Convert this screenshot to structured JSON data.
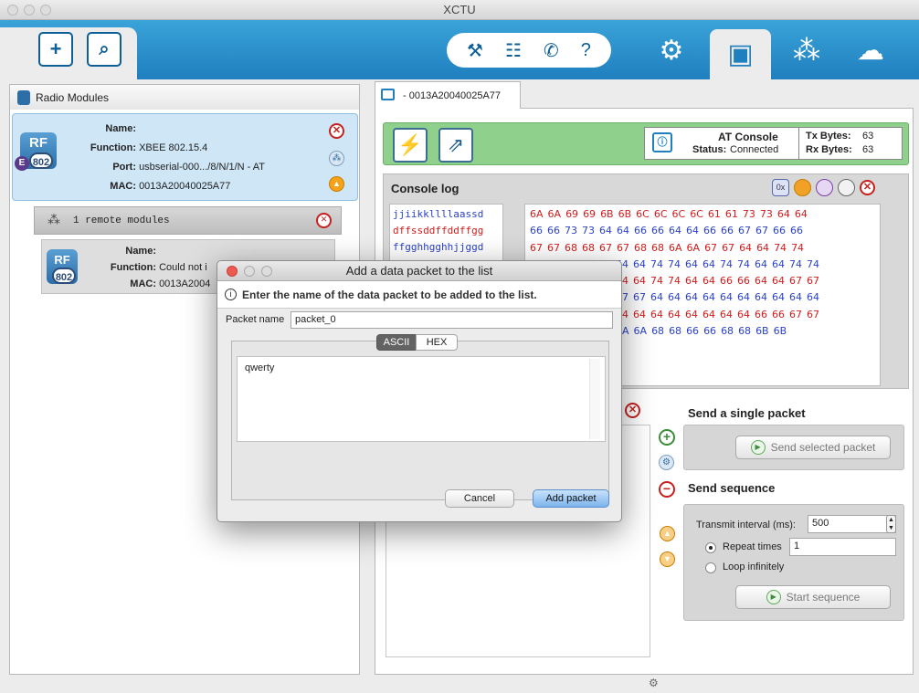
{
  "window": {
    "title": "XCTU"
  },
  "left_panel": {
    "header": "Radio Modules",
    "module": {
      "name_label": "Name:",
      "name_value": "",
      "function_label": "Function:",
      "function_value": "XBEE 802.15.4",
      "port_label": "Port:",
      "port_value": "usbserial-000.../8/N/1/N - AT",
      "mac_label": "MAC:",
      "mac_value": "0013A20040025A77",
      "icon_text": "RF",
      "badge": "802",
      "badge_letter": "E"
    },
    "remote_bar": "1 remote modules",
    "remote": {
      "name_label": "Name:",
      "function_label": "Function:",
      "function_value": "Could not i",
      "mac_label": "MAC:",
      "mac_value": "0013A2004"
    }
  },
  "console": {
    "tab": "- 0013A20040025A77",
    "at": {
      "title": "AT Console",
      "status_label": "Status:",
      "status_value": "Connected",
      "tx_label": "Tx Bytes:",
      "tx_value": "63",
      "rx_label": "Rx Bytes:",
      "rx_value": "63"
    },
    "log_title": "Console log",
    "ascii_lines": [
      "jjiikkllllaassd",
      "dffssddffddffgg",
      "ffgghhgghhjjggd",
      "",
      "",
      "",
      "",
      ""
    ],
    "hex_lines": [
      [
        "6A",
        "6A",
        "69",
        "69",
        "6B",
        "6B",
        "6C",
        "6C",
        "6C",
        "6C",
        "61",
        "61",
        "73",
        "73",
        "64",
        "64"
      ],
      [
        "66",
        "66",
        "73",
        "73",
        "64",
        "64",
        "66",
        "66",
        "64",
        "64",
        "66",
        "66",
        "67",
        "67",
        "66",
        "66"
      ],
      [
        "67",
        "67",
        "68",
        "68",
        "67",
        "67",
        "68",
        "68",
        "6A",
        "6A",
        "67",
        "67",
        "64",
        "64",
        "74",
        "74"
      ],
      [
        "54",
        "64",
        "74",
        "74",
        "64",
        "64",
        "74",
        "74",
        "64",
        "64",
        "74",
        "74"
      ],
      [
        "54",
        "64",
        "74",
        "74",
        "64",
        "64",
        "66",
        "66",
        "64",
        "64",
        "67",
        "67"
      ],
      [
        "57",
        "67",
        "64",
        "64",
        "64",
        "64",
        "64",
        "64",
        "64",
        "64",
        "64",
        "64"
      ],
      [
        "54",
        "64",
        "64",
        "64",
        "64",
        "64",
        "64",
        "64",
        "66",
        "66",
        "67",
        "67"
      ],
      [
        "5A",
        "6A",
        "68",
        "68",
        "66",
        "66",
        "68",
        "68",
        "6B",
        "6B"
      ]
    ]
  },
  "send": {
    "single_title": "Send a single packet",
    "single_button": "Send selected packet",
    "sequence_title": "Send sequence",
    "interval_label": "Transmit interval (ms):",
    "interval_value": "500",
    "repeat_label": "Repeat times",
    "repeat_value": "1",
    "loop_label": "Loop infinitely",
    "start_button": "Start sequence"
  },
  "dialog": {
    "title": "Add a data packet to the list",
    "message": "Enter the name of the data packet to be added to the list.",
    "name_label": "Packet name",
    "name_value": "packet_0",
    "tab_ascii": "ASCII",
    "tab_hex": "HEX",
    "content": "qwerty",
    "cancel": "Cancel",
    "add": "Add packet"
  },
  "colors": {
    "accent": "#1f7fbf",
    "green": "#8fd08c",
    "hex_red": "#d21c1c",
    "hex_blue": "#2b41c9"
  }
}
